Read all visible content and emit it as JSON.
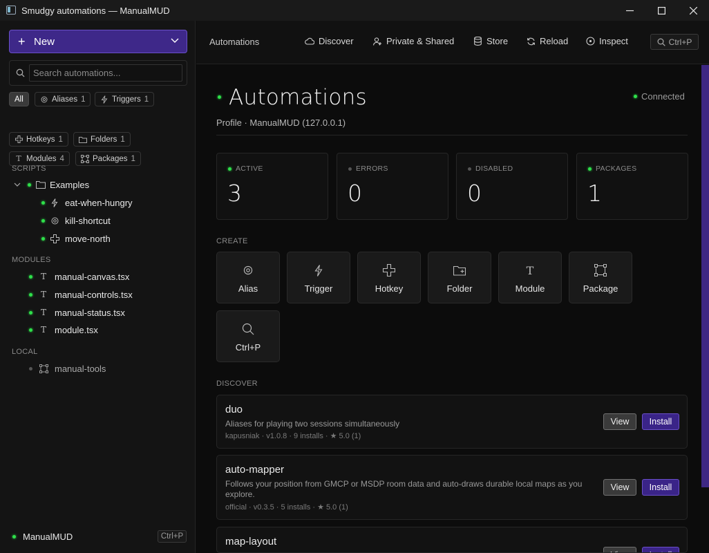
{
  "window": {
    "title": "Smudgy automations — ManualMUD"
  },
  "sidebar": {
    "new_label": "New",
    "search_placeholder": "Search automations...",
    "filters": [
      {
        "label": "All",
        "count": ""
      },
      {
        "label": "Aliases",
        "count": "1"
      },
      {
        "label": "Triggers",
        "count": "1"
      },
      {
        "label": "Hotkeys",
        "count": "1"
      },
      {
        "label": "Folders",
        "count": "1"
      },
      {
        "label": "Modules",
        "count": "4"
      },
      {
        "label": "Packages",
        "count": "1"
      }
    ],
    "sections": {
      "scripts": "SCRIPTS",
      "modules": "MODULES",
      "local": "LOCAL"
    },
    "folder": {
      "name": "Examples"
    },
    "scripts": [
      {
        "name": "eat-when-hungry",
        "icon": "trigger-icon"
      },
      {
        "name": "kill-shortcut",
        "icon": "alias-icon"
      },
      {
        "name": "move-north",
        "icon": "hotkey-icon"
      }
    ],
    "modules": [
      {
        "name": "manual-canvas.tsx"
      },
      {
        "name": "manual-controls.tsx"
      },
      {
        "name": "manual-status.tsx"
      },
      {
        "name": "module.tsx"
      }
    ],
    "local": [
      {
        "name": "manual-tools"
      }
    ],
    "footer": {
      "server": "ManualMUD",
      "shortcut": "Ctrl+P"
    }
  },
  "topbar": {
    "crumb": "Automations",
    "items": [
      {
        "label": "Discover",
        "icon": "cloud-icon"
      },
      {
        "label": "Private & Shared",
        "icon": "users-icon"
      },
      {
        "label": "Store",
        "icon": "database-icon"
      },
      {
        "label": "Reload",
        "icon": "reload-icon"
      },
      {
        "label": "Inspect",
        "icon": "inspect-icon"
      }
    ],
    "search_shortcut": "Ctrl+P"
  },
  "main": {
    "title": "Automations",
    "status": "Connected",
    "profile": "Profile · ManualMUD (127.0.0.1)",
    "stats": [
      {
        "label": "ACTIVE",
        "value": "3",
        "status": "green"
      },
      {
        "label": "ERRORS",
        "value": "0",
        "status": "grey"
      },
      {
        "label": "DISABLED",
        "value": "0",
        "status": "grey"
      },
      {
        "label": "PACKAGES",
        "value": "1",
        "status": "green"
      }
    ],
    "create_heading": "CREATE",
    "create_tiles": [
      {
        "label": "Alias",
        "icon": "alias-icon"
      },
      {
        "label": "Trigger",
        "icon": "trigger-icon"
      },
      {
        "label": "Hotkey",
        "icon": "hotkey-icon"
      },
      {
        "label": "Folder",
        "icon": "folder-plus-icon"
      },
      {
        "label": "Module",
        "icon": "module-icon"
      },
      {
        "label": "Package",
        "icon": "package-icon"
      },
      {
        "label": "Ctrl+P",
        "icon": "search-icon"
      }
    ],
    "discover_heading": "DISCOVER",
    "packages": [
      {
        "name": "duo",
        "description": "Aliases for playing two sessions simultaneously",
        "meta": "kapusniak · v1.0.8 · 9 installs · ★ 5.0 (1)",
        "view_label": "View",
        "install_label": "Install"
      },
      {
        "name": "auto-mapper",
        "description": "Follows your position from GMCP or MSDP room data and auto-draws durable local maps as you explore.",
        "meta": "official · v0.3.5 · 5 installs · ★ 5.0 (1)",
        "view_label": "View",
        "install_label": "Install"
      },
      {
        "name": "map-layout",
        "description": "",
        "meta": "",
        "view_label": "View",
        "install_label": "Install"
      }
    ]
  },
  "colors": {
    "accent": "#3e2889",
    "status_green": "#2ee04a"
  }
}
